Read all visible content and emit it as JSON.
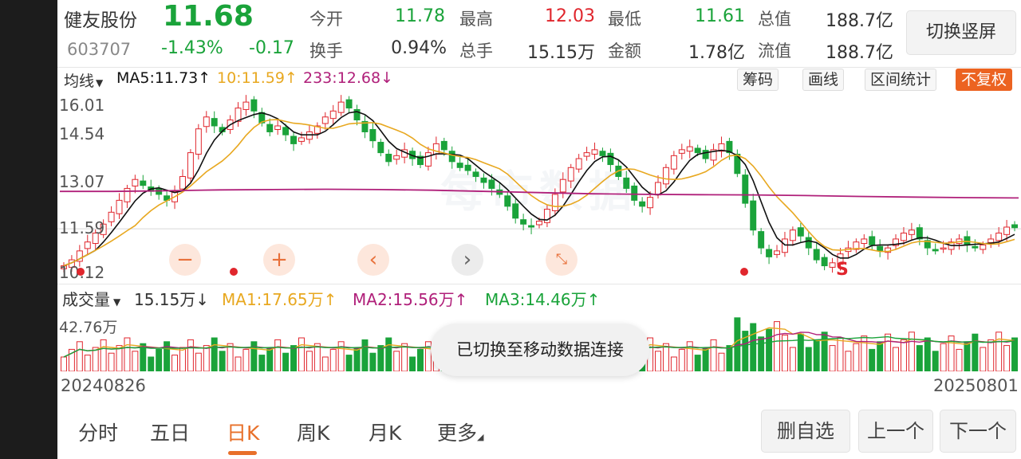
{
  "header": {
    "stock_name": "健友股份",
    "stock_code": "603707",
    "price": "11.68",
    "change_pct": "-1.43%",
    "change_amt": "-0.17",
    "switch_button": "切换竖屏",
    "stats": [
      {
        "label": "今开",
        "value": "11.78",
        "color": "green"
      },
      {
        "label": "最高",
        "value": "12.03",
        "color": "red"
      },
      {
        "label": "最低",
        "value": "11.61",
        "color": "green"
      },
      {
        "label": "总值",
        "value": "188.7亿",
        "color": "dark"
      },
      {
        "label": "换手",
        "value": "0.94%",
        "color": "dark"
      },
      {
        "label": "总手",
        "value": "15.15万",
        "color": "dark"
      },
      {
        "label": "金额",
        "value": "1.78亿",
        "color": "dark"
      },
      {
        "label": "流值",
        "value": "188.7亿",
        "color": "dark"
      }
    ]
  },
  "ma_bar": {
    "selector": "均线",
    "ma5": "MA5:11.73",
    "ma10": "10:11.59",
    "ma233": "233:12.68",
    "arrow_up": "↑",
    "arrow_down": "↓",
    "buttons": [
      "筹码",
      "画线",
      "区间统计"
    ],
    "fq_button": "不复权"
  },
  "price_axis": [
    "16.01",
    "14.54",
    "13.07",
    "11.59",
    "10.12"
  ],
  "watermark": "每市数据",
  "volume_bar": {
    "selector": "成交量",
    "vol": "15.15万",
    "vol_arrow": "↓",
    "ma1": "MA1:17.65万",
    "ma2": "MA2:15.56万",
    "ma3": "MA3:14.46万",
    "arrow_up": "↑",
    "max_label": "42.76万"
  },
  "signal_label": "S",
  "toast": "已切换至移动数据连接",
  "dates": {
    "start": "20240826",
    "end": "20250801"
  },
  "period_tabs": [
    "分时",
    "五日",
    "日K",
    "周K",
    "月K",
    "更多"
  ],
  "active_tab": "日K",
  "nav_buttons": {
    "delete": "删自选",
    "prev": "上一个",
    "next": "下一个"
  },
  "colors": {
    "up": "#e0262d",
    "down": "#1aa33a",
    "ma5": "#111111",
    "ma10": "#e8a820",
    "ma233": "#b0207a",
    "accent": "#e8702a"
  },
  "chart_data": {
    "type": "candlestick",
    "title": "",
    "ylim": [
      10.12,
      16.01
    ],
    "closes": [
      10.4,
      10.6,
      10.9,
      11.2,
      11.5,
      11.8,
      12.2,
      12.6,
      13.0,
      13.3,
      13.1,
      12.9,
      12.8,
      12.6,
      12.9,
      13.4,
      14.2,
      15.0,
      15.4,
      15.1,
      14.9,
      15.3,
      15.7,
      15.9,
      15.6,
      15.2,
      14.9,
      15.1,
      14.8,
      14.5,
      14.7,
      14.9,
      15.1,
      15.4,
      15.6,
      15.9,
      15.7,
      15.3,
      14.9,
      14.6,
      14.2,
      13.9,
      14.1,
      14.3,
      14.0,
      13.8,
      14.2,
      14.5,
      14.3,
      13.9,
      13.7,
      13.6,
      13.4,
      13.2,
      13.0,
      12.8,
      12.4,
      12.0,
      11.8,
      11.7,
      11.9,
      12.3,
      12.8,
      13.3,
      13.7,
      14.0,
      14.2,
      14.3,
      14.1,
      13.8,
      13.4,
      13.0,
      12.6,
      12.4,
      12.7,
      13.2,
      13.7,
      14.1,
      14.3,
      14.4,
      14.2,
      14.0,
      14.3,
      14.5,
      14.2,
      13.5,
      12.5,
      11.6,
      11.0,
      10.7,
      10.9,
      11.3,
      11.6,
      11.4,
      11.0,
      10.6,
      10.4,
      10.5,
      10.8,
      11.0,
      11.2,
      11.3,
      11.1,
      10.9,
      11.0,
      11.3,
      11.5,
      11.6,
      11.3,
      11.0,
      10.9,
      11.0,
      11.2,
      11.3,
      11.1,
      11.0,
      11.1,
      11.3,
      11.5,
      11.7,
      11.68
    ],
    "ma233": [
      12.9,
      12.9,
      12.92,
      12.95,
      12.96,
      12.97,
      12.96,
      12.94,
      12.9,
      12.86,
      12.82,
      12.8,
      12.79,
      12.78,
      12.76,
      12.73,
      12.71,
      12.69,
      12.68
    ],
    "volume_max": "42.76万"
  }
}
